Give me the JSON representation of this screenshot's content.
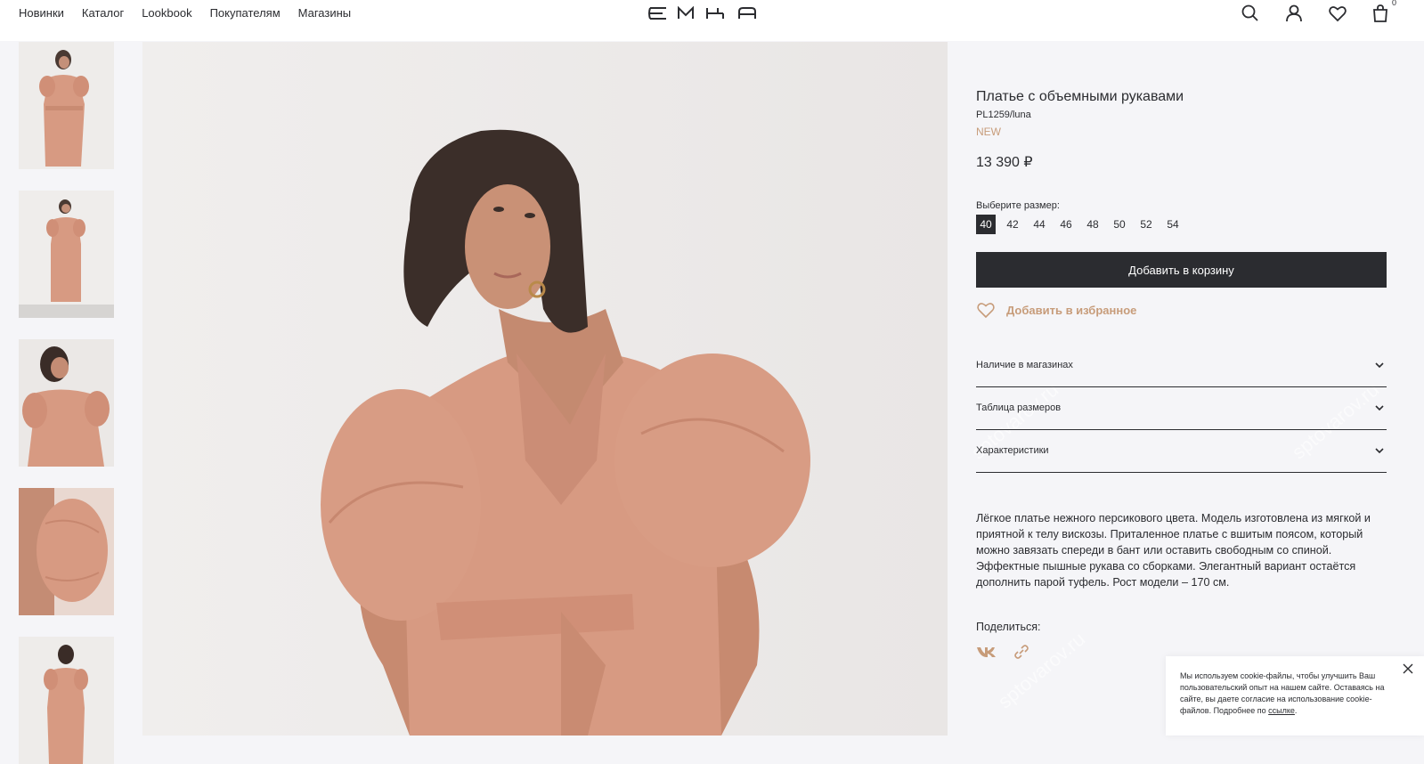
{
  "header": {
    "nav": [
      "Новинки",
      "Каталог",
      "Lookbook",
      "Покупателям",
      "Магазины"
    ],
    "logo_text": "EMKA",
    "cart_count": "0",
    "icons": [
      "search-icon",
      "user-icon",
      "heart-icon",
      "bag-icon"
    ]
  },
  "gallery": {
    "thumbnails": [
      "thumb-1",
      "thumb-2",
      "thumb-3",
      "thumb-4",
      "thumb-5"
    ]
  },
  "product": {
    "title": "Платье с объемными рукавами",
    "sku": "PL1259/luna",
    "badge": "NEW",
    "price": "13 390 ₽",
    "size_label": "Выберите размер:",
    "sizes": [
      "40",
      "42",
      "44",
      "46",
      "48",
      "50",
      "52",
      "54"
    ],
    "selected_size": "40",
    "add_to_cart": "Добавить в корзину",
    "add_to_fav": "Добавить в избранное",
    "accordion": [
      "Наличие в магазинах",
      "Таблица размеров",
      "Характеристики"
    ],
    "description": "Лёгкое платье нежного персикового цвета. Модель изготовлена из мягкой и приятной к телу вискозы. Приталенное платье с вшитым поясом, который можно завязать спереди в бант или оставить свободным со спиной. Эффектные пышные рукава со сборками. Элегантный вариант остаётся дополнить парой туфель. Рост модели – 170 см.",
    "share_label": "Поделиться:"
  },
  "cookie": {
    "text": "Мы используем cookie-файлы, чтобы улучшить Ваш пользовательский опыт на нашем сайте. Оставаясь на сайте, вы даете согласие на использование cookie-файлов. Подробнее по",
    "link": "ссылке",
    "end": "."
  },
  "watermark": "sptovarov.ru",
  "colors": {
    "accent": "#c79c7a",
    "dark": "#2b2c30",
    "dress": "#d79a82",
    "background": "#f5f5f8"
  }
}
